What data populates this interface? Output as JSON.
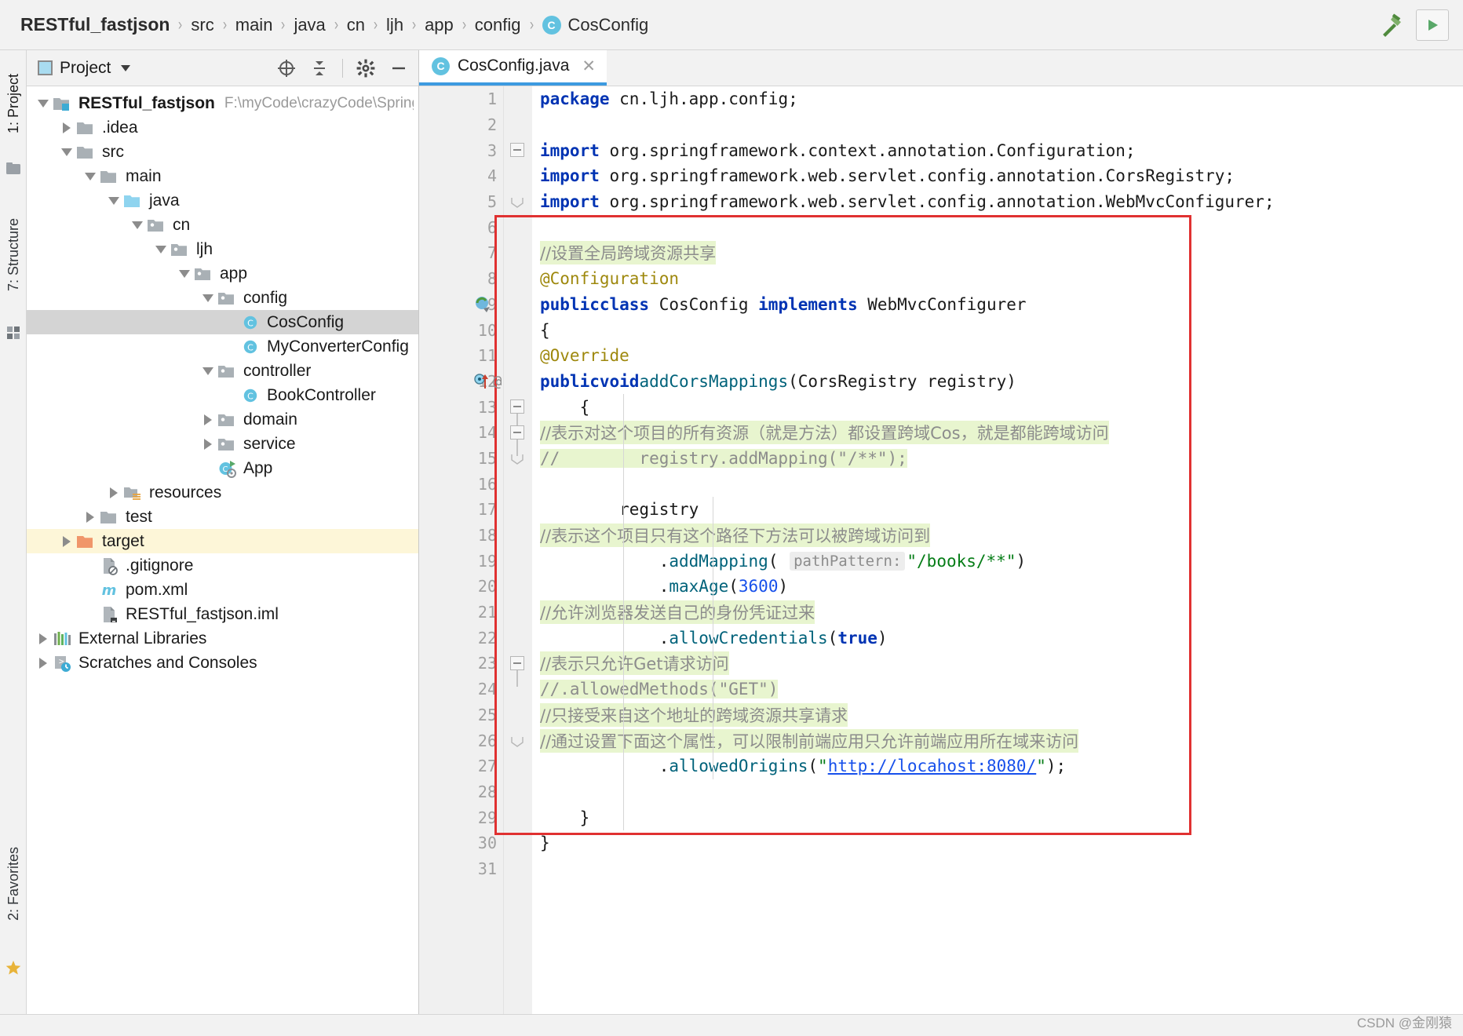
{
  "breadcrumb": {
    "items": [
      {
        "label": "RESTful_fastjson",
        "type": "project"
      },
      {
        "label": "src",
        "type": "folder"
      },
      {
        "label": "main",
        "type": "folder"
      },
      {
        "label": "java",
        "type": "folder"
      },
      {
        "label": "cn",
        "type": "package"
      },
      {
        "label": "ljh",
        "type": "package"
      },
      {
        "label": "app",
        "type": "package"
      },
      {
        "label": "config",
        "type": "package"
      },
      {
        "label": "CosConfig",
        "type": "class",
        "badge": "C"
      }
    ],
    "separator": "›"
  },
  "toolbar": {
    "build_icon": "hammer-icon",
    "run_icon": "run-icon"
  },
  "left_tool_strip": {
    "tabs": [
      {
        "label": "1: Project",
        "icon": "project-icon",
        "selected": true
      },
      {
        "label": "7: Structure",
        "icon": "structure-icon",
        "selected": false
      },
      {
        "label": "2: Favorites",
        "icon": "favorites-icon",
        "selected": false
      }
    ]
  },
  "project_panel": {
    "title": "Project",
    "dropdown_icon": "chevron-down-icon",
    "tools": [
      {
        "name": "locate-icon",
        "tooltip": "Select Opened File"
      },
      {
        "name": "collapse-all-icon",
        "tooltip": "Collapse All"
      },
      {
        "name": "gear-icon",
        "tooltip": "Settings"
      },
      {
        "name": "minimize-icon",
        "tooltip": "Hide"
      }
    ],
    "tree": [
      {
        "label": "RESTful_fastjson",
        "path": "F:\\myCode\\crazyCode\\SpringB",
        "depth": 0,
        "icon": "module-folder-icon",
        "twisty": "down",
        "bold": true
      },
      {
        "label": ".idea",
        "depth": 1,
        "icon": "folder-icon",
        "twisty": "right"
      },
      {
        "label": "src",
        "depth": 1,
        "icon": "folder-icon",
        "twisty": "down"
      },
      {
        "label": "main",
        "depth": 2,
        "icon": "folder-icon",
        "twisty": "down"
      },
      {
        "label": "java",
        "depth": 3,
        "icon": "source-folder-icon",
        "twisty": "down"
      },
      {
        "label": "cn",
        "depth": 4,
        "icon": "package-icon",
        "twisty": "down"
      },
      {
        "label": "ljh",
        "depth": 5,
        "icon": "package-icon",
        "twisty": "down"
      },
      {
        "label": "app",
        "depth": 6,
        "icon": "package-icon",
        "twisty": "down"
      },
      {
        "label": "config",
        "depth": 7,
        "icon": "package-icon",
        "twisty": "down"
      },
      {
        "label": "CosConfig",
        "depth": 8,
        "icon": "class-icon",
        "twisty": "none",
        "state": "selected"
      },
      {
        "label": "MyConverterConfig",
        "depth": 8,
        "icon": "class-icon",
        "twisty": "none"
      },
      {
        "label": "controller",
        "depth": 7,
        "icon": "package-icon",
        "twisty": "down"
      },
      {
        "label": "BookController",
        "depth": 8,
        "icon": "class-icon",
        "twisty": "none"
      },
      {
        "label": "domain",
        "depth": 7,
        "icon": "package-icon",
        "twisty": "right"
      },
      {
        "label": "service",
        "depth": 7,
        "icon": "package-icon",
        "twisty": "right"
      },
      {
        "label": "App",
        "depth": 7,
        "icon": "runnable-class-icon",
        "twisty": "none"
      },
      {
        "label": "resources",
        "depth": 3,
        "icon": "resource-folder-icon",
        "twisty": "right"
      },
      {
        "label": "test",
        "depth": 2,
        "icon": "folder-icon",
        "twisty": "right"
      },
      {
        "label": "target",
        "depth": 1,
        "icon": "excluded-folder-icon",
        "twisty": "right",
        "state": "highlighted"
      },
      {
        "label": ".gitignore",
        "depth": 2,
        "icon": "gitignore-file-icon",
        "twisty": "none"
      },
      {
        "label": "pom.xml",
        "depth": 2,
        "icon": "maven-icon",
        "twisty": "none"
      },
      {
        "label": "RESTful_fastjson.iml",
        "depth": 2,
        "icon": "iml-file-icon",
        "twisty": "none"
      },
      {
        "label": "External Libraries",
        "depth": 0,
        "icon": "libraries-icon",
        "twisty": "right"
      },
      {
        "label": "Scratches and Consoles",
        "depth": 0,
        "icon": "scratches-icon",
        "twisty": "right"
      }
    ]
  },
  "editor": {
    "tab": {
      "label": "CosConfig.java",
      "badge": "C",
      "close_icon": "close-icon"
    },
    "first_line": 1,
    "last_line": 31,
    "lines": [
      {
        "n": 1,
        "text": "package cn.ljh.app.config;"
      },
      {
        "n": 2,
        "text": ""
      },
      {
        "n": 3,
        "text": "import org.springframework.context.annotation.Configuration;"
      },
      {
        "n": 4,
        "text": "import org.springframework.web.servlet.config.annotation.CorsRegistry;"
      },
      {
        "n": 5,
        "text": "import org.springframework.web.servlet.config.annotation.WebMvcConfigurer;"
      },
      {
        "n": 6,
        "text": ""
      },
      {
        "n": 7,
        "text": "//设置全局跨域资源共享"
      },
      {
        "n": 8,
        "text": "@Configuration"
      },
      {
        "n": 9,
        "text": "public class CosConfig implements WebMvcConfigurer"
      },
      {
        "n": 10,
        "text": "{"
      },
      {
        "n": 11,
        "text": "    @Override"
      },
      {
        "n": 12,
        "text": "    public void addCorsMappings(CorsRegistry registry)"
      },
      {
        "n": 13,
        "text": "    {"
      },
      {
        "n": 14,
        "text": "        //表示对这个项目的所有资源（就是方法）都设置跨域Cos，就是都能跨域访问"
      },
      {
        "n": 15,
        "text": "//        registry.addMapping(\"/**\");"
      },
      {
        "n": 16,
        "text": ""
      },
      {
        "n": 17,
        "text": "        registry"
      },
      {
        "n": 18,
        "text": "            //表示这个项目只有这个路径下方法可以被跨域访问到"
      },
      {
        "n": 19,
        "text": "            .addMapping( pathPattern: \"/books/**\")"
      },
      {
        "n": 20,
        "text": "            .maxAge(3600)"
      },
      {
        "n": 21,
        "text": "            //允许浏览器发送自己的身份凭证过来"
      },
      {
        "n": 22,
        "text": "            .allowCredentials(true)"
      },
      {
        "n": 23,
        "text": "            //表示只允许Get请求访问"
      },
      {
        "n": 24,
        "text": "            //.allowedMethods(\"GET\")"
      },
      {
        "n": 25,
        "text": "            //只接受来自这个地址的跨域资源共享请求"
      },
      {
        "n": 26,
        "text": "            //通过设置下面这个属性，可以限制前端应用只允许前端应用所在域来访问"
      },
      {
        "n": 27,
        "text": "            .allowedOrigins(\"http://locahost:8080/\");"
      },
      {
        "n": 28,
        "text": ""
      },
      {
        "n": 29,
        "text": "    }"
      },
      {
        "n": 30,
        "text": "}"
      },
      {
        "n": 31,
        "text": ""
      }
    ],
    "gutter_markers": [
      {
        "line": 9,
        "icon": "spring-bean-icon"
      },
      {
        "line": 12,
        "icon": "implementing-method-icon",
        "extra": "@"
      }
    ],
    "parameter_hint": {
      "line": 19,
      "label": "pathPattern:"
    },
    "annotation_box": {
      "color": "#e03131",
      "from_line": 6,
      "to_line": 29
    },
    "colors": {
      "keyword": "#0033b3",
      "annotation": "#9e880d",
      "string": "#067d17",
      "number": "#1750eb",
      "method": "#00627a",
      "comment": "#8c8c8c",
      "comment_highlight_bg": "#e8f5cf",
      "selection_bg": "#d4d4d4"
    }
  },
  "footer": {
    "watermark": "CSDN @金刚猿"
  }
}
